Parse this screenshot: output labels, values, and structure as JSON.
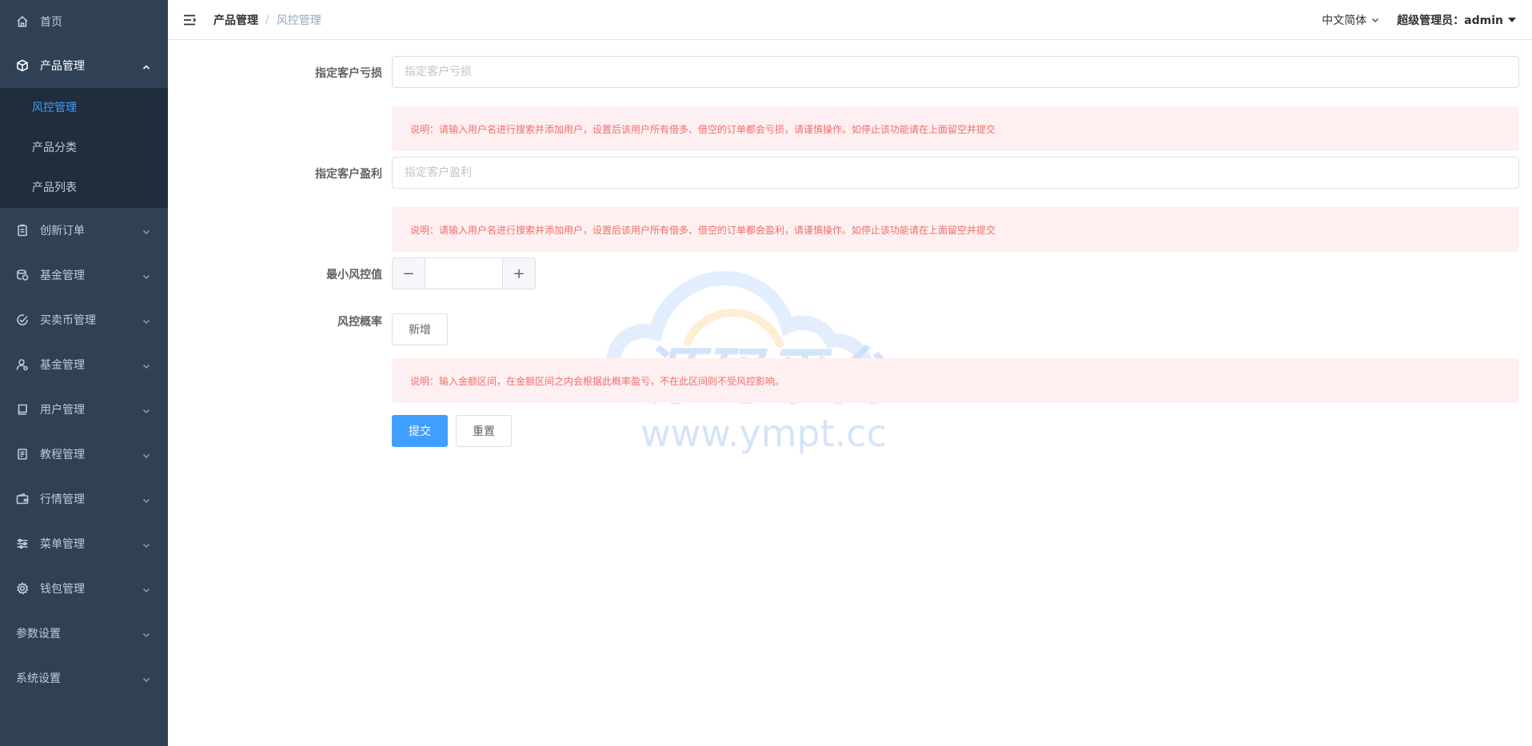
{
  "sidebar": {
    "home": "首页",
    "product_mgmt": "产品管理",
    "product_sub": [
      "风控管理",
      "产品分类",
      "产品列表"
    ],
    "menus": [
      "创新订单",
      "基金管理",
      "买卖币管理",
      "基金管理",
      "用户管理",
      "教程管理",
      "行情管理",
      "菜单管理",
      "钱包管理",
      "参数设置",
      "系统设置"
    ]
  },
  "header": {
    "breadcrumb": [
      "产品管理",
      "风控管理"
    ],
    "language": "中文简体",
    "user": "超级管理员：admin"
  },
  "form": {
    "loss": {
      "label": "指定客户亏损",
      "placeholder": "指定客户亏损",
      "note": "说明：请输入用户名进行搜索并添加用户，设置后该用户所有借多、借空的订单都会亏损，请谨慎操作。如停止该功能请在上面留空并提交"
    },
    "profit": {
      "label": "指定客户盈利",
      "placeholder": "指定客户盈利",
      "note": "说明：请输入用户名进行搜索并添加用户，设置后该用户所有借多、借空的订单都会盈利，请谨慎操作。如停止该功能请在上面留空并提交"
    },
    "min_risk": {
      "label": "最小风控值",
      "value": "",
      "minus": "−",
      "plus": "+"
    },
    "risk_prob": {
      "label": "风控概率",
      "add_button": "新增",
      "note": "说明：输入金额区间，在金额区间之内会根据此概率盈亏，不在此区间则不受风控影响。"
    },
    "submit": "提交",
    "reset": "重置"
  },
  "watermark": {
    "title": "源码平台",
    "url": "www.ympt.cc"
  },
  "colors": {
    "sidebar_bg": "#304156",
    "submenu_bg": "#1f2d3d",
    "primary": "#409eff",
    "alert_bg": "#fef0f0",
    "alert_text": "#f56c6c"
  }
}
